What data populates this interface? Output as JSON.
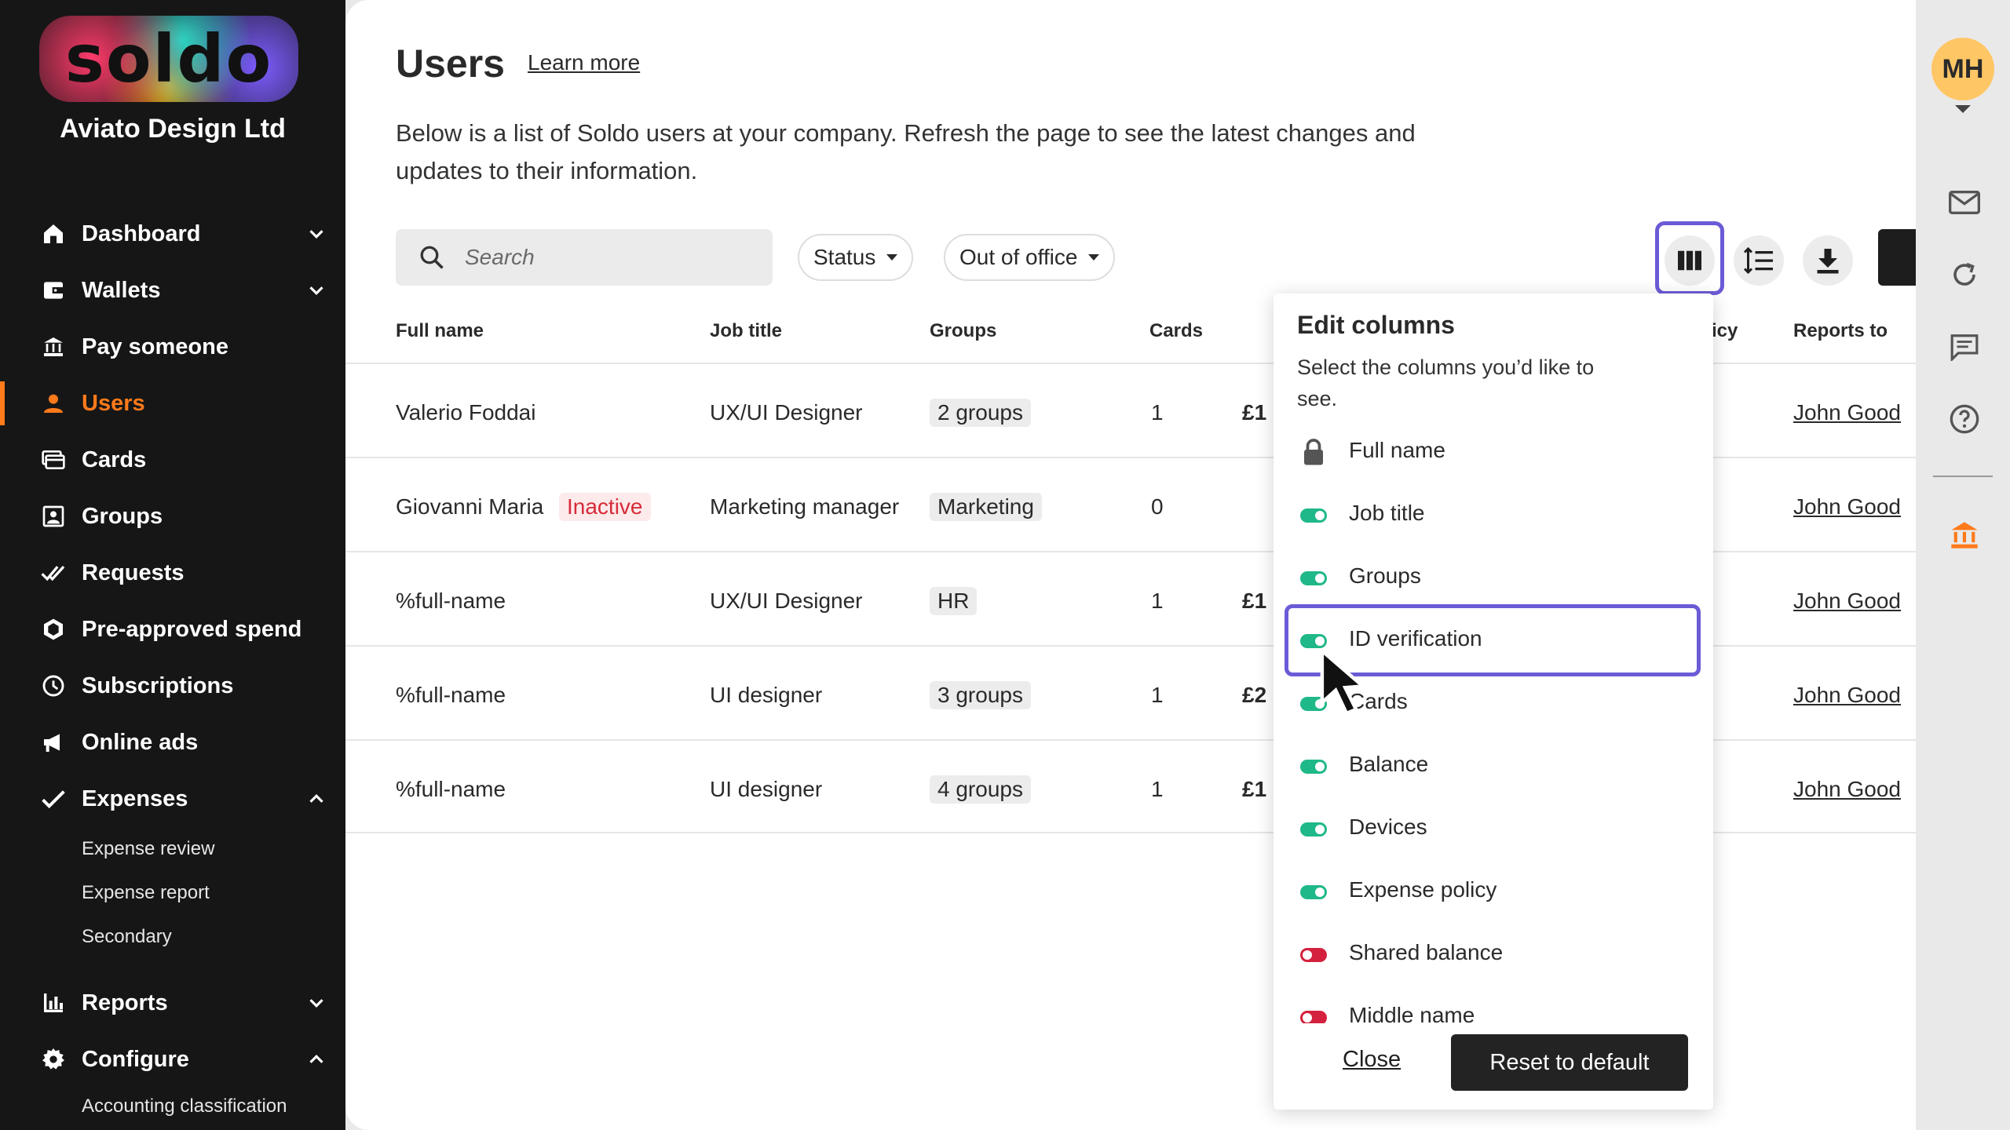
{
  "sidebar": {
    "logo": "soldo",
    "company": "Aviato Design Ltd",
    "items": [
      {
        "label": "Dashboard",
        "icon": "home-icon"
      },
      {
        "label": "Wallets",
        "icon": "wallet-icon"
      },
      {
        "label": "Pay someone",
        "icon": "bank-transfer-icon"
      },
      {
        "label": "Users",
        "icon": "user-icon"
      },
      {
        "label": "Cards",
        "icon": "cards-icon"
      },
      {
        "label": "Groups",
        "icon": "groups-icon"
      },
      {
        "label": "Requests",
        "icon": "double-check-icon"
      },
      {
        "label": "Pre-approved spend",
        "icon": "hexagon-icon"
      },
      {
        "label": "Subscriptions",
        "icon": "clock-icon"
      },
      {
        "label": "Online ads",
        "icon": "megaphone-icon"
      },
      {
        "label": "Expenses",
        "icon": "check-icon"
      },
      {
        "label": "Reports",
        "icon": "bar-chart-icon"
      },
      {
        "label": "Configure",
        "icon": "gear-icon"
      }
    ],
    "expenses_sub": [
      "Expense review",
      "Expense report",
      "Secondary"
    ],
    "configure_sub": [
      "Accounting classification"
    ],
    "active": "Users"
  },
  "header": {
    "title": "Users",
    "learn_more": "Learn more",
    "description": "Below is a list of Soldo users at your company. Refresh the page to see the latest changes and updates to their information."
  },
  "filters": {
    "search_placeholder": "Search",
    "status": "Status",
    "out_of_office": "Out of office"
  },
  "table": {
    "headers": {
      "full_name": "Full name",
      "job_title": "Job title",
      "groups": "Groups",
      "cards": "Cards",
      "policy_partial": "icy",
      "reports_to": "Reports to"
    },
    "rows": [
      {
        "name": "Valerio Foddai",
        "status": "",
        "job": "UX/UI Designer",
        "group": "2 groups",
        "cards": "1",
        "balance": "£1",
        "reports_to": "John Good"
      },
      {
        "name": "Giovanni Maria",
        "status": "Inactive",
        "job": "Marketing manager",
        "group": "Marketing",
        "cards": "0",
        "balance": "",
        "reports_to": "John Good"
      },
      {
        "name": "%full-name",
        "status": "",
        "job": "UX/UI Designer",
        "group": "HR",
        "cards": "1",
        "balance": "£1",
        "reports_to": "John Good"
      },
      {
        "name": "%full-name",
        "status": "",
        "job": "UI designer",
        "group": "3 groups",
        "cards": "1",
        "balance": "£2",
        "reports_to": "John Good"
      },
      {
        "name": "%full-name",
        "status": "",
        "job": "UI designer",
        "group": "4 groups",
        "cards": "1",
        "balance": "£1",
        "reports_to": "John Good"
      }
    ]
  },
  "edit_columns": {
    "title": "Edit columns",
    "subtitle": "Select the columns you’d like to see.",
    "options": [
      {
        "label": "Full name",
        "state": "locked"
      },
      {
        "label": "Job title",
        "state": "on"
      },
      {
        "label": "Groups",
        "state": "on"
      },
      {
        "label": "ID verification",
        "state": "on"
      },
      {
        "label": "Cards",
        "state": "on"
      },
      {
        "label": "Balance",
        "state": "on"
      },
      {
        "label": "Devices",
        "state": "on"
      },
      {
        "label": "Expense policy",
        "state": "on"
      },
      {
        "label": "Shared balance",
        "state": "off"
      },
      {
        "label": "Middle name",
        "state": "off"
      }
    ],
    "close": "Close",
    "reset": "Reset to default"
  },
  "rail": {
    "avatar": "MH"
  },
  "colors": {
    "accent": "#ff7a1a",
    "toggle_on": "#1fb889",
    "toggle_off": "#d4213d",
    "highlight": "#6b5bd6"
  }
}
